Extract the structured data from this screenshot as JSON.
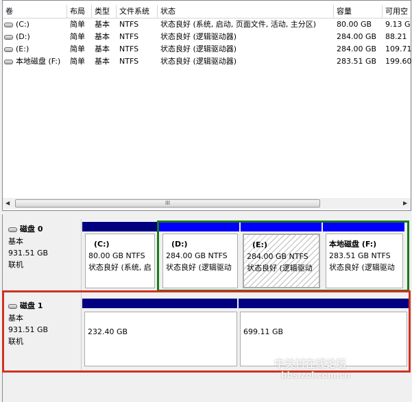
{
  "table": {
    "headers": [
      "卷",
      "布局",
      "类型",
      "文件系统",
      "状态",
      "容量",
      "可用空"
    ],
    "rows": [
      [
        "(C:)",
        "简单",
        "基本",
        "NTFS",
        "状态良好 (系统, 启动, 页面文件, 活动, 主分区)",
        "80.00 GB",
        "9.13 G"
      ],
      [
        "(D:)",
        "简单",
        "基本",
        "NTFS",
        "状态良好 (逻辑驱动器)",
        "284.00 GB",
        "88.21"
      ],
      [
        "(E:)",
        "简单",
        "基本",
        "NTFS",
        "状态良好 (逻辑驱动器)",
        "284.00 GB",
        "109.71"
      ],
      [
        "本地磁盘 (F:)",
        "简单",
        "基本",
        "NTFS",
        "状态良好 (逻辑驱动器)",
        "283.51 GB",
        "199.60"
      ]
    ],
    "scroll_thumb": "III"
  },
  "disks": [
    {
      "name": "磁盘 0",
      "type": "基本",
      "size": "931.51 GB",
      "status": "联机",
      "partitions": [
        {
          "label": "(C:)",
          "size": "80.00 GB NTFS",
          "status": "状态良好 (系统, 启"
        },
        {
          "label": "(D:)",
          "size": "284.00 GB NTFS",
          "status": "状态良好 (逻辑驱动"
        },
        {
          "label": "(E:)",
          "size": "284.00 GB NTFS",
          "status": "状态良好 (逻辑驱动"
        },
        {
          "label": "本地磁盘  (F:)",
          "size": "283.51 GB NTFS",
          "status": "状态良好 (逻辑驱动"
        }
      ]
    },
    {
      "name": "磁盘 1",
      "type": "基本",
      "size": "931.51 GB",
      "status": "联机",
      "partitions": [
        {
          "size": "232.40 GB"
        },
        {
          "size": "699.11 GB"
        }
      ]
    }
  ],
  "watermark": {
    "line1": "中关村在线论坛",
    "line2": "bbs.zol.com.cn"
  },
  "colors": {
    "primary_bar": "#000080",
    "logical_bar": "#0000ff",
    "green_box": "#1a7a1a",
    "red_box": "#d03020"
  }
}
